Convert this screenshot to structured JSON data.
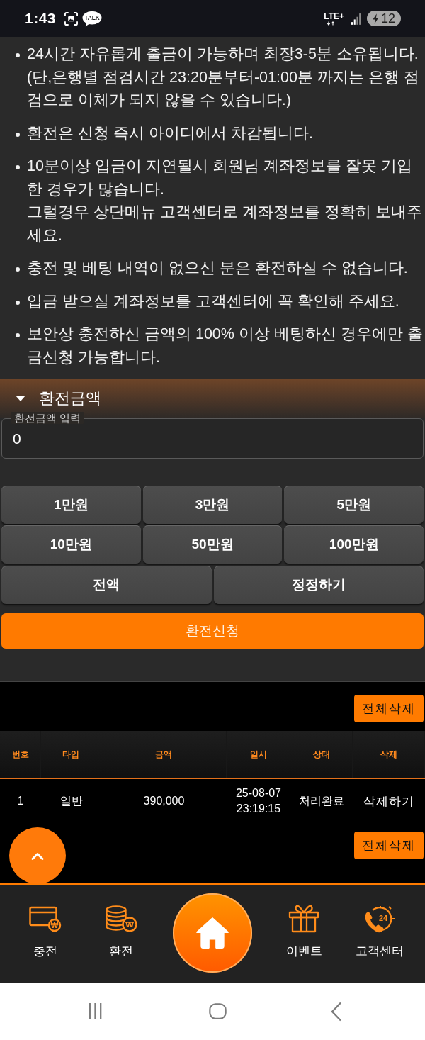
{
  "status_bar": {
    "time": "1:43",
    "talk_badge": "TALK",
    "network": "LTE+",
    "battery": "12"
  },
  "notices": [
    {
      "lines": [
        "24시간 자유롭게 출금이 가능하며 최장3-5분 소유됩니다. (단,은행별 점검시간 23:20분부터-01:00분 까지는 은행 점검으로 이체가 되지 않을 수 있습니다.)"
      ]
    },
    {
      "lines": [
        "환전은 신청 즉시 아이디에서 차감됩니다."
      ]
    },
    {
      "lines": [
        "10분이상 입금이 지연될시 회원님 계좌정보를 잘못 기입한 경우가 많습니다.",
        "그럴경우 상단메뉴 고객센터로 계좌정보를 정확히 보내주세요."
      ]
    },
    {
      "lines": [
        "충전 및 베팅 내역이 없으신 분은 환전하실 수 없습니다."
      ]
    },
    {
      "lines": [
        "입금 받으실 계좌정보를 고객센터에 꼭 확인해 주세요."
      ]
    },
    {
      "lines": [
        "보안상 충전하신 금액의 100% 이상 베팅하신 경우에만 출금신청 가능합니다."
      ]
    }
  ],
  "section": {
    "title": "환전금액",
    "expanded": true
  },
  "amount_field": {
    "label": "환전금액 입력",
    "value": "0"
  },
  "amount_buttons": [
    "1만원",
    "3만원",
    "5만원",
    "10만원",
    "50만원",
    "100만원"
  ],
  "action_buttons": [
    "전액",
    "정정하기"
  ],
  "submit_button": "환전신청",
  "history": {
    "delete_all_top": "전체삭제",
    "columns": [
      "번호",
      "타입",
      "금액",
      "일시",
      "상태",
      "삭제"
    ],
    "rows": [
      {
        "cells": [
          "1",
          "일반",
          "390,000",
          "25-08-07 23:19:15",
          "처리완료"
        ],
        "action": "삭제하기"
      }
    ],
    "delete_all_bottom": "전체삭제"
  },
  "bottom_nav": [
    {
      "kind": "charge",
      "label": "충전",
      "icon_text": "₩"
    },
    {
      "kind": "exchange",
      "label": "환전",
      "icon_text": "₩"
    },
    {
      "kind": "home"
    },
    {
      "kind": "event",
      "label": "이벤트"
    },
    {
      "kind": "support",
      "label": "고객센터",
      "icon_text": "24"
    }
  ]
}
